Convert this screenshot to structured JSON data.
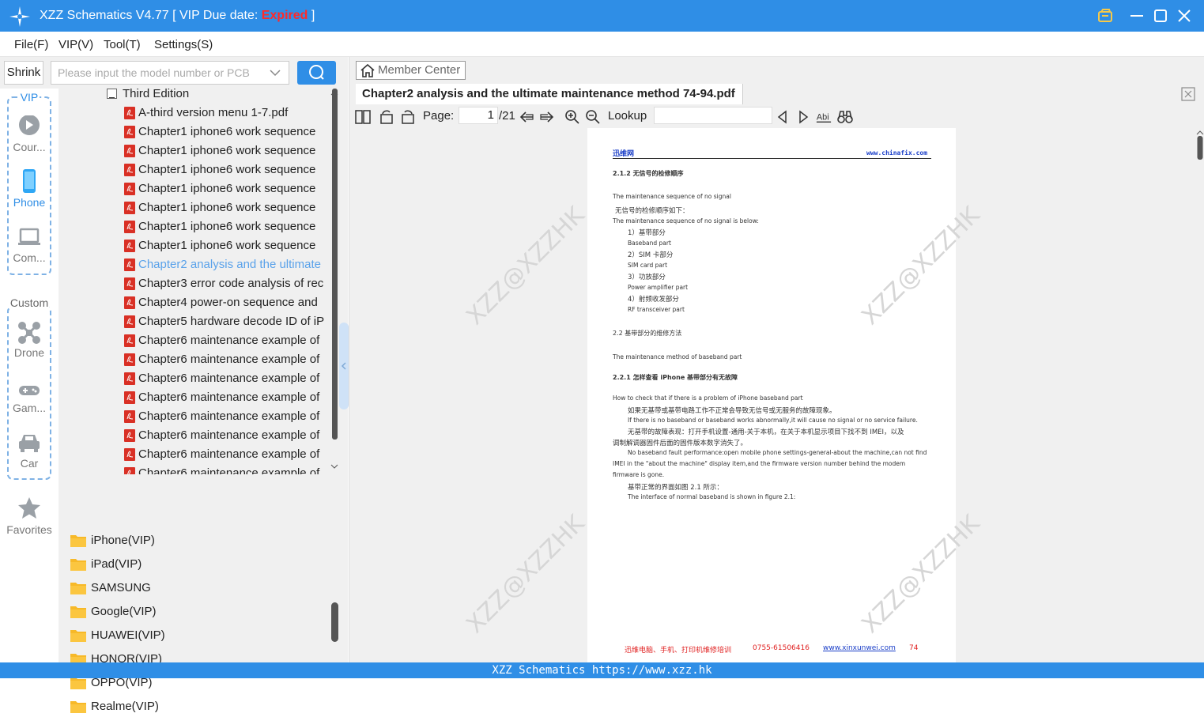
{
  "app": {
    "title_main": "XZZ Schematics V4.77 [ VIP Due date: ",
    "title_status": "Expired",
    "title_end": " ]"
  },
  "menu": [
    "File(F)",
    "VIP(V)",
    "Tool(T)",
    "Settings(S)"
  ],
  "sidebar": {
    "shrink_label": "Shrink",
    "search_placeholder": "Please input the model number or PCB",
    "vip_group_title": "VIP",
    "vip_items": [
      {
        "label": "Cour...",
        "icon": "play-circle-icon"
      },
      {
        "label": "Phone",
        "icon": "phone-icon"
      },
      {
        "label": "Com...",
        "icon": "laptop-icon"
      }
    ],
    "custom_group_title": "Custom",
    "custom_items": [
      {
        "label": "Drone",
        "icon": "drone-icon"
      },
      {
        "label": "Gam...",
        "icon": "gamepad-icon"
      },
      {
        "label": "Car",
        "icon": "car-icon"
      }
    ],
    "favorites_label": "Favorites"
  },
  "tree": {
    "edition": "Third Edition",
    "files": [
      "A-third version menu  1-7.pdf",
      "Chapter1 iphone6 work sequence",
      "Chapter1 iphone6 work sequence",
      "Chapter1 iphone6 work sequence",
      "Chapter1 iphone6 work sequence",
      "Chapter1 iphone6 work sequence",
      "Chapter1 iphone6 work sequence",
      "Chapter1 iphone6 work sequence",
      "Chapter2 analysis and the ultimate",
      "Chapter3 error code analysis of rec",
      "Chapter4 power-on sequence and",
      "Chapter5 hardware decode ID of iP",
      "Chapter6 maintenance example of",
      "Chapter6 maintenance example of",
      "Chapter6 maintenance example of",
      "Chapter6 maintenance example of",
      "Chapter6 maintenance example of",
      "Chapter6 maintenance example of",
      "Chapter6 maintenance example of",
      "Chapter6 maintenance example of"
    ],
    "selected_index": 8
  },
  "folders": [
    "iPhone(VIP)",
    "iPad(VIP)",
    "SAMSUNG",
    "Google(VIP)",
    "HUAWEI(VIP)",
    "HONOR(VIP)",
    "OPPO(VIP)",
    "Realme(VIP)"
  ],
  "viewer": {
    "member_center": "Member Center",
    "doc_title": "Chapter2 analysis and the ultimate maintenance method 74-94.pdf",
    "page_label": "Page:",
    "page_current": "1",
    "page_total": "/21",
    "lookup_label": "Lookup",
    "lookup_value": ""
  },
  "document": {
    "header_left": "迅维网",
    "header_right": "www.chinafix.com",
    "lines": [
      "2.1.2 无信号的检修顺序",
      "The maintenance sequence of no signal",
      "无信号的检修顺序如下：",
      "The maintenance sequence of no signal is below:",
      "1）基带部分",
      "Baseband part",
      "2）SIM 卡部分",
      "SIM card part",
      "3）功放部分",
      "Power amplifier part",
      "4）射频收发部分",
      "RF transceiver part",
      "2.2 基带部分的维修方法",
      "The maintenance method of baseband part",
      "2.2.1 怎样查看 iPhone 基带部分有无故障",
      "How to check that if there is a problem of iPhone baseband part",
      "如果无基带或基带电路工作不正常会导致无信号或无服务的故障现象。",
      "If there is no baseband or baseband works abnormally,it will cause no signal or no service failure.",
      "无基带的故障表现：打开手机设置-通用-关于本机，在关于本机显示项目下找不到 IMEI，以及",
      "调制解调器固件后面的固件版本数字消失了。",
      "No baseband fault performance:open mobile phone settings-general-about the machine,can not find",
      "IMEI in the \"about the machine\" display item,and the firmware version number behind the modem",
      "firmware is gone.",
      "基带正常的界面如图 2.1 所示：",
      "The interface of normal baseband is shown in figure 2.1:"
    ],
    "footer_text": "迅维电脑、手机、打印机维修培训",
    "footer_phone": "0755-61506416",
    "footer_url": "www.xinxunwei.com",
    "footer_page": "74",
    "watermark": "XZZ@XZZHK"
  },
  "status_bar": "XZZ Schematics https://www.xzz.hk",
  "colors": {
    "accent": "#2f8ee6",
    "expired": "#ff2a2a",
    "selected": "#5aa2ea",
    "pdf_red": "#d93025",
    "folder": "#f7b928"
  }
}
